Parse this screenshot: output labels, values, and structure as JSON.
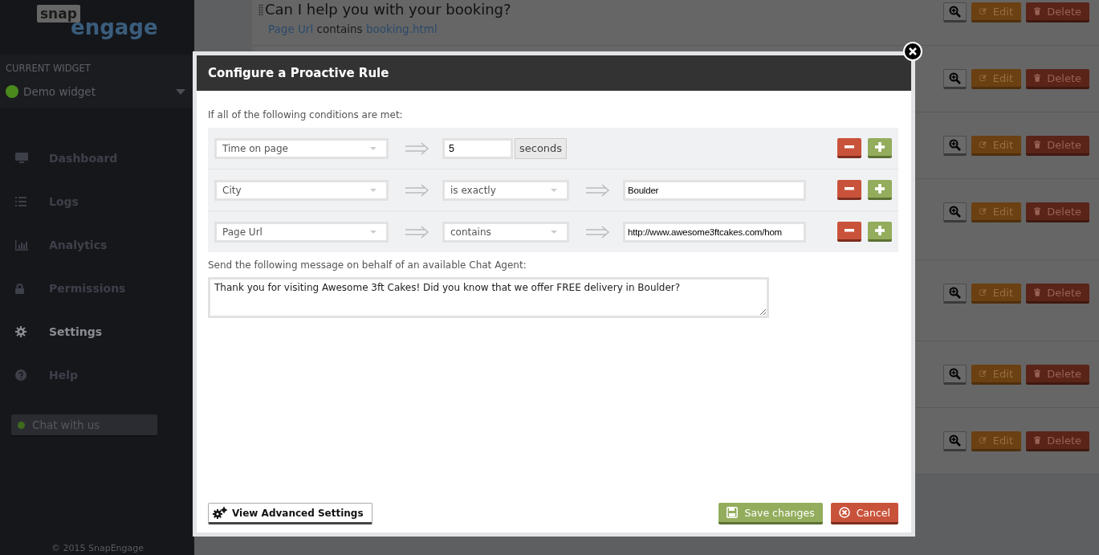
{
  "sidebar": {
    "logo": {
      "top": "snap",
      "bottom": "engage"
    },
    "current_widget_label": "CURRENT WIDGET",
    "widget_name": "Demo widget",
    "nav": [
      {
        "label": "Dashboard",
        "selected": false
      },
      {
        "label": "Logs",
        "selected": false
      },
      {
        "label": "Analytics",
        "selected": false
      },
      {
        "label": "Permissions",
        "selected": false
      },
      {
        "label": "Settings",
        "selected": true
      },
      {
        "label": "Help",
        "selected": false
      }
    ],
    "chat_button": "Chat with us",
    "copyright": "© 2015 SnapEngage"
  },
  "rules": [
    {
      "title": "Can I help you with your booking?",
      "condition": {
        "field": "Page Url",
        "operator": "contains",
        "value": "booking.html"
      },
      "edit": "Edit",
      "delete": "Delete"
    },
    {
      "edit": "Edit",
      "delete": "Delete"
    },
    {
      "edit": "Edit",
      "delete": "Delete"
    },
    {
      "edit": "Edit",
      "delete": "Delete"
    },
    {
      "edit": "Edit",
      "delete": "Delete"
    },
    {
      "edit": "Edit",
      "delete": "Delete"
    },
    {
      "edit": "Edit",
      "delete": "Delete"
    }
  ],
  "modal": {
    "title": "Configure a Proactive Rule",
    "conditions_label": "If all of the following conditions are met:",
    "conditions": [
      {
        "kind": "duration",
        "field": "Time on page",
        "value": "5",
        "unit": "seconds"
      },
      {
        "kind": "match",
        "field": "City",
        "operator": "is exactly",
        "value": "Boulder"
      },
      {
        "kind": "match",
        "field": "Page Url",
        "operator": "contains",
        "value": "http://www.awesome3ftcakes.com/hom"
      }
    ],
    "message_label": "Send the following message on behalf of an available Chat Agent:",
    "message": "Thank you for visiting Awesome 3ft Cakes! Did you know that we offer FREE delivery in Boulder?",
    "advanced_button": "View Advanced Settings",
    "save_button": "Save changes",
    "cancel_button": "Cancel"
  }
}
